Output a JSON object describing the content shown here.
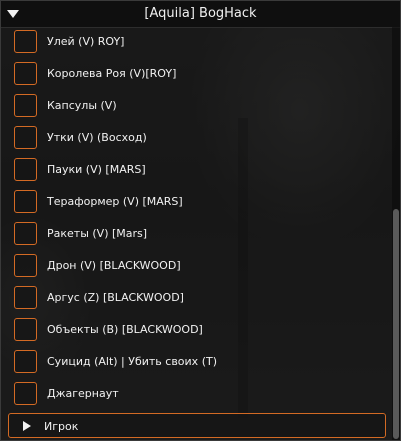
{
  "window": {
    "title": "[Aquila] BogHack"
  },
  "options": [
    {
      "label": "Улей (V) ROY]"
    },
    {
      "label": "Королева Роя (V)[ROY]"
    },
    {
      "label": "Капсулы (V)"
    },
    {
      "label": "Утки (V) (Восход)"
    },
    {
      "label": "Пауки (V) [MARS]"
    },
    {
      "label": "Тераформер (V) [MARS]"
    },
    {
      "label": "Ракеты (V) [Mars]"
    },
    {
      "label": "Дрон (V) [BLACKWOOD]"
    },
    {
      "label": "Аргус (Z) [BLACKWOOD]"
    },
    {
      "label": "Объекты (B) [BLACKWOOD]"
    },
    {
      "label": "Суицид (Alt) | Убить своих (T)"
    },
    {
      "label": "Джагернаут"
    }
  ],
  "collapsed_section": {
    "label": "Игрок"
  },
  "colors": {
    "accent": "#d36a24",
    "text": "#f2f2f2",
    "title_bar": "#0e0e0e"
  }
}
